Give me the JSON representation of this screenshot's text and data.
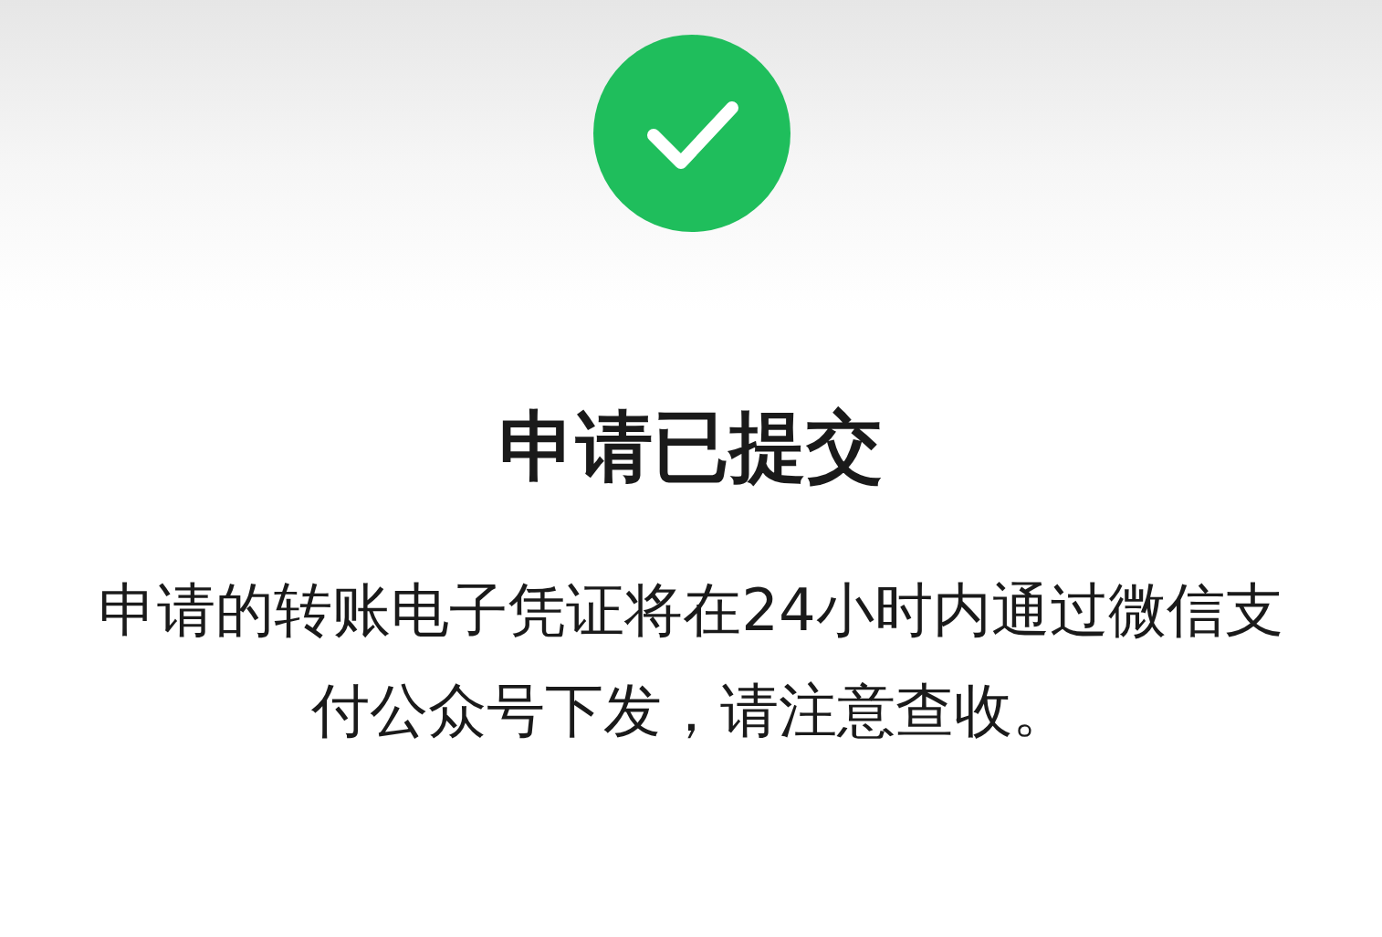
{
  "status": {
    "kind": "success"
  },
  "title": "申请已提交",
  "message": "申请的转账电子凭证将在24小时内通过微信支付公众号下发，请注意查收。"
}
